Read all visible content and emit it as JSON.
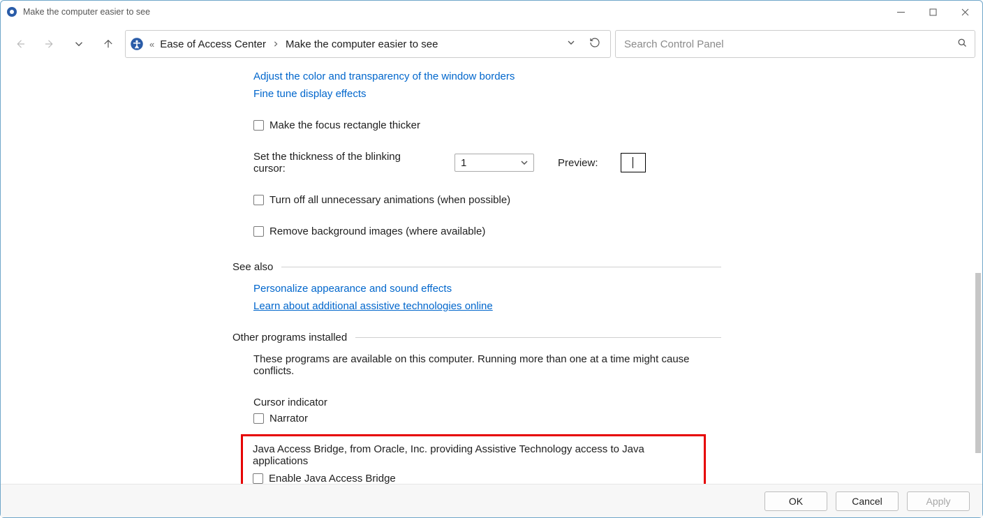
{
  "titlebar": {
    "title": "Make the computer easier to see"
  },
  "breadcrumb": {
    "root": "Ease of Access Center",
    "current": "Make the computer easier to see"
  },
  "search": {
    "placeholder": "Search Control Panel"
  },
  "links": {
    "adjust_borders": "Adjust the color and transparency of the window borders",
    "fine_tune": "Fine tune display effects",
    "personalize": "Personalize appearance and sound effects",
    "learn_online": "Learn about additional assistive technologies online"
  },
  "checkboxes": {
    "focus_thicker": "Make the focus rectangle thicker",
    "turn_off_anim": "Turn off all unnecessary animations (when possible)",
    "remove_bg": "Remove background images (where available)",
    "narrator": "Narrator",
    "enable_jab": "Enable Java Access Bridge"
  },
  "thickness": {
    "label": "Set the thickness of the blinking cursor:",
    "value": "1",
    "preview_label": "Preview:"
  },
  "sections": {
    "see_also": "See also",
    "other_programs": "Other programs installed"
  },
  "other_programs": {
    "desc": "These programs are available on this computer. Running more than one at a time might cause conflicts.",
    "cursor_indicator": "Cursor indicator",
    "jab_desc": "Java Access Bridge, from Oracle, Inc. providing Assistive Technology access to Java applications"
  },
  "footer": {
    "ok": "OK",
    "cancel": "Cancel",
    "apply": "Apply"
  }
}
